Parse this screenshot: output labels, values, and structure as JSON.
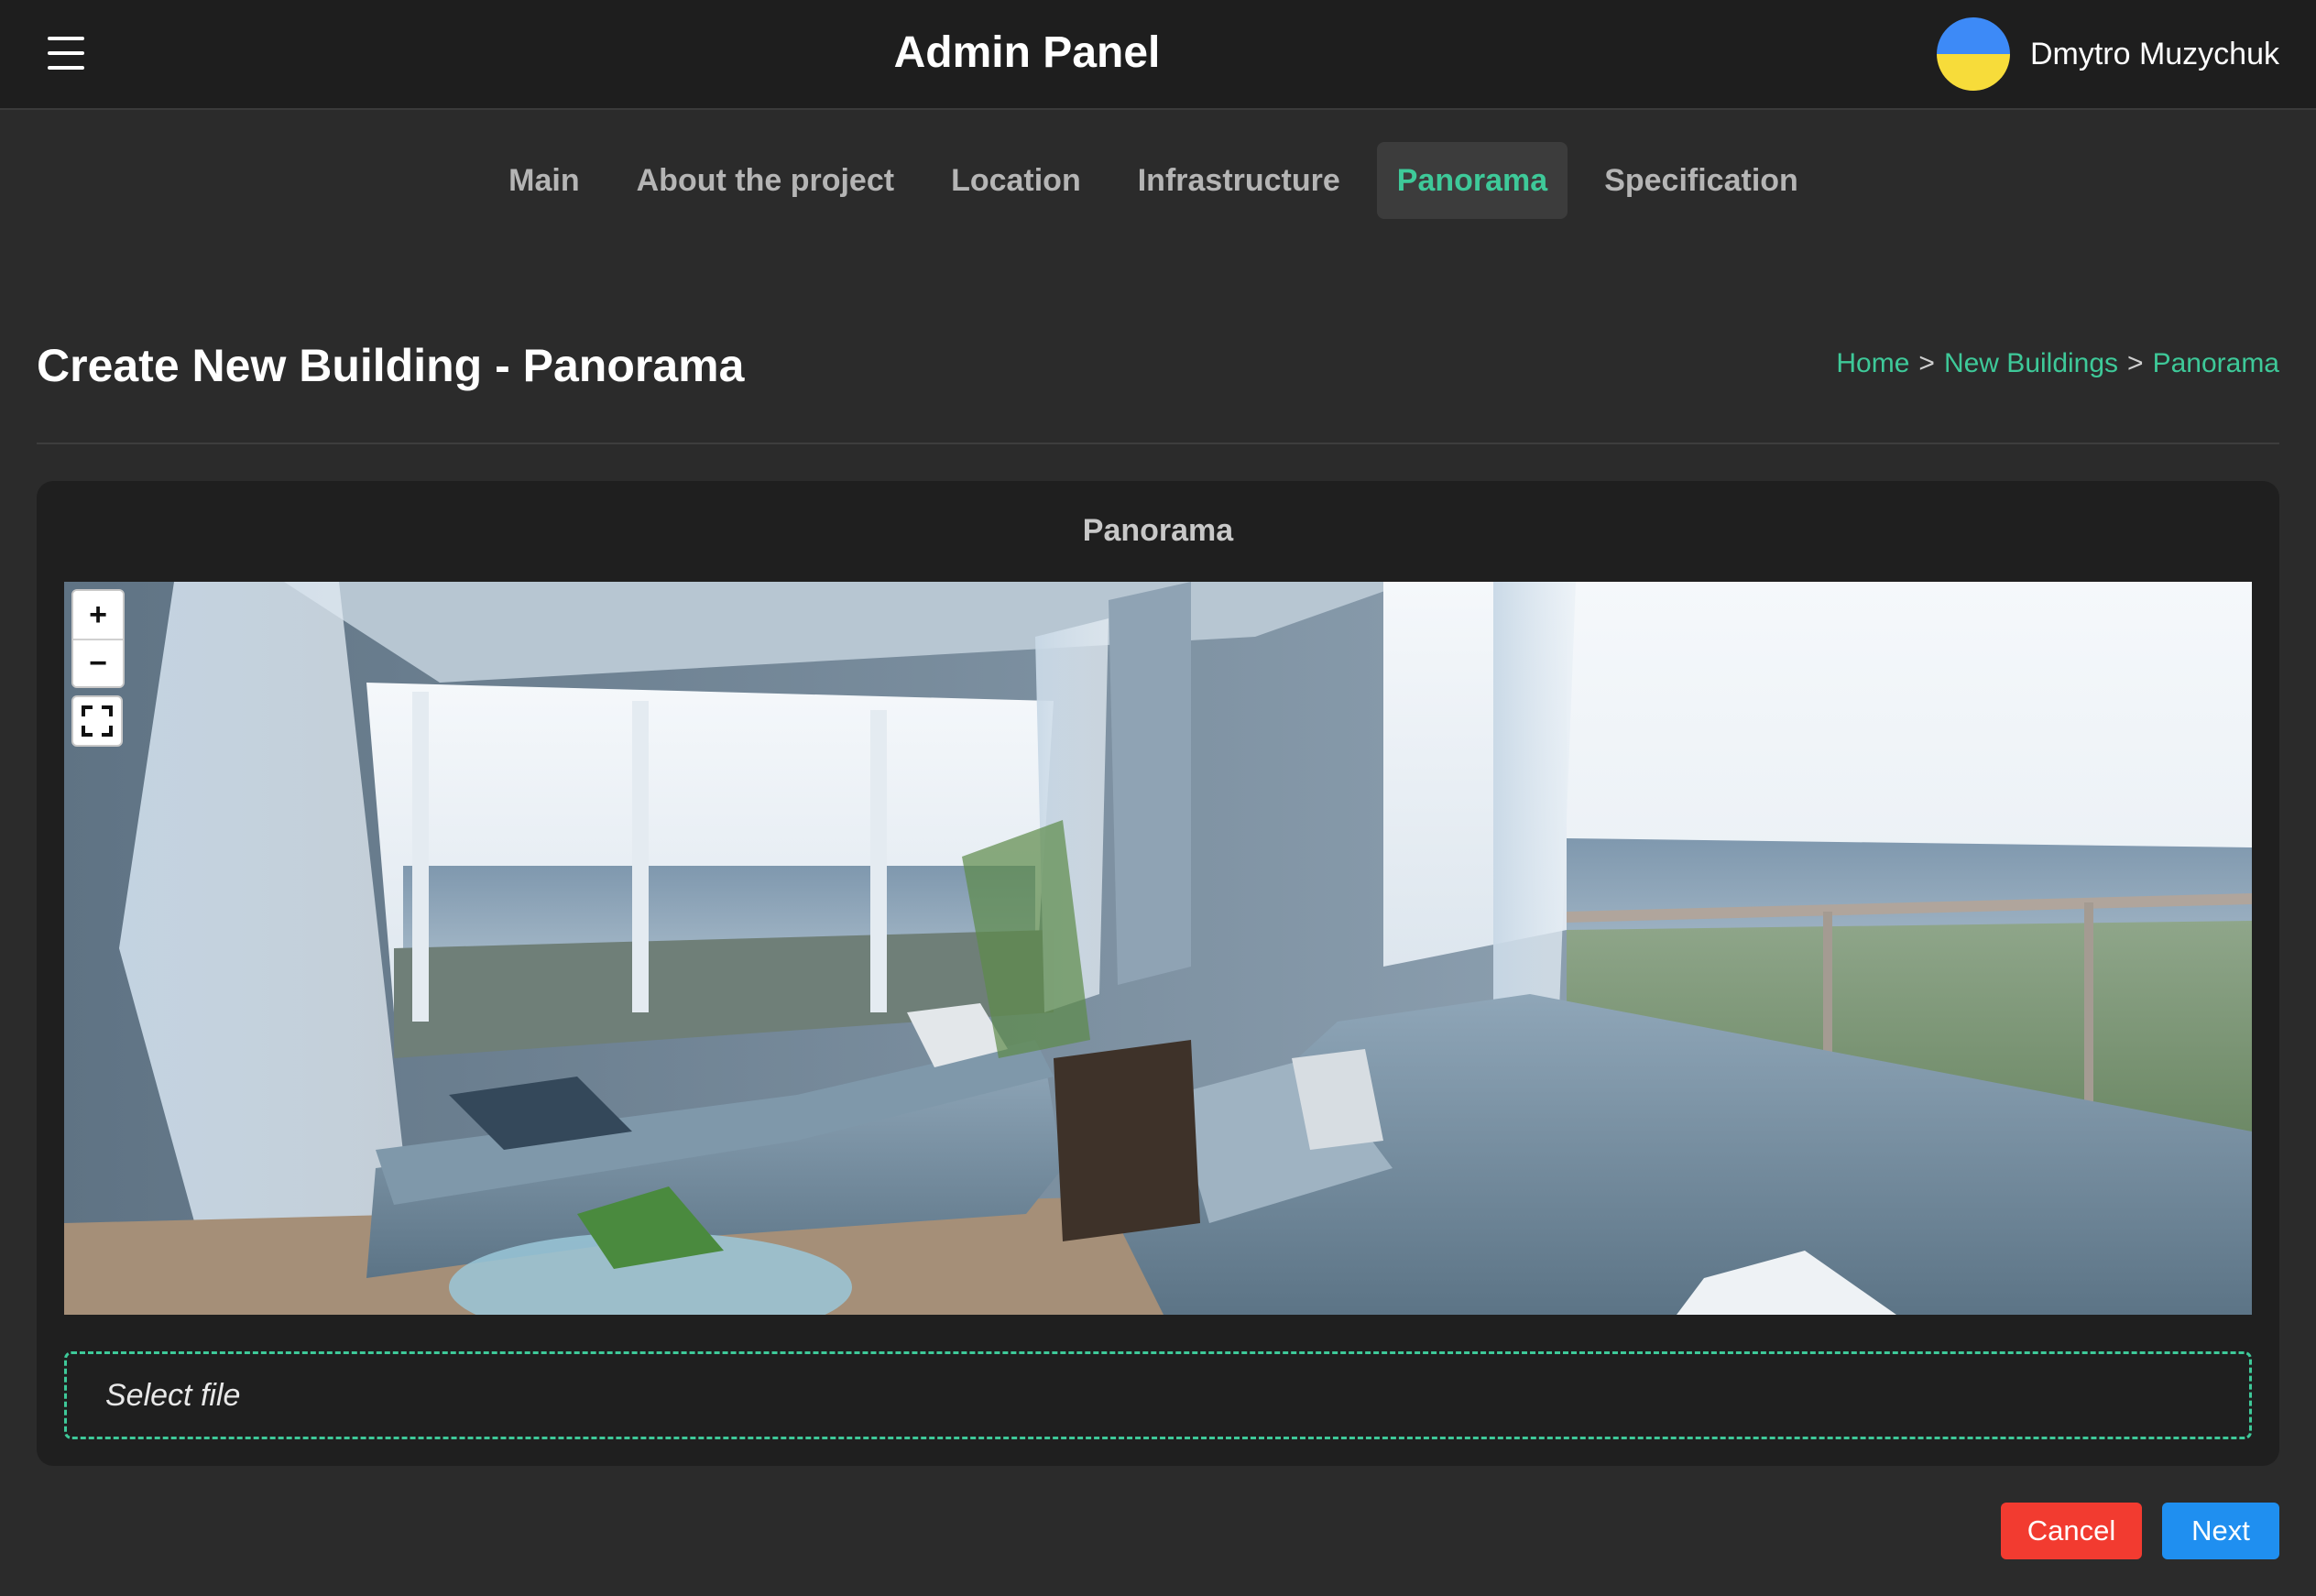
{
  "header": {
    "menu_icon": "hamburger-menu-icon",
    "title": "Admin Panel",
    "user": {
      "name": "Dmytro Muzychuk",
      "avatar_colors": [
        "#3d8af7",
        "#f7dc3a"
      ]
    }
  },
  "tabs": [
    {
      "label": "Main",
      "active": false
    },
    {
      "label": "About the project",
      "active": false
    },
    {
      "label": "Location",
      "active": false
    },
    {
      "label": "Infrastructure",
      "active": false
    },
    {
      "label": "Panorama",
      "active": true
    },
    {
      "label": "Specification",
      "active": false
    }
  ],
  "page": {
    "title": "Create New Building - Panorama",
    "breadcrumb": {
      "home": "Home",
      "sep1": ">",
      "section": "New Buildings",
      "sep2": ">",
      "current": "Panorama"
    }
  },
  "panorama_card": {
    "title": "Panorama",
    "controls": {
      "zoom_in": "+",
      "zoom_out": "−",
      "fullscreen_icon": "fullscreen-icon"
    },
    "file_input_placeholder": "Select file"
  },
  "actions": {
    "cancel": "Cancel",
    "next": "Next"
  },
  "colors": {
    "accent": "#3ec999",
    "cancel": "#f23b30",
    "next": "#1f8ff0",
    "background": "#2b2b2b",
    "header": "#1e1e1e"
  }
}
